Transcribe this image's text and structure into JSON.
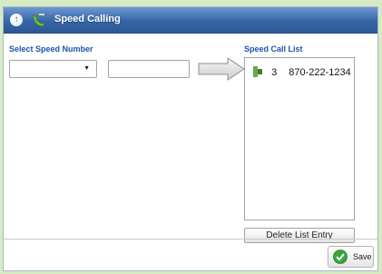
{
  "window": {
    "title": "Speed Calling"
  },
  "left_panel": {
    "label": "Select Speed Number",
    "select_value": "",
    "text_value": ""
  },
  "right_panel": {
    "label": "Speed Call List",
    "items": [
      {
        "number": "3",
        "phone": "870-222-1234"
      }
    ],
    "delete_label": "Delete List Entry"
  },
  "footer": {
    "save_label": "Save"
  },
  "icons": {
    "up": "up-arrow-icon",
    "title": "phone-icon",
    "transfer": "right-arrow-icon",
    "list_item": "phone-entry-icon",
    "save": "check-icon"
  },
  "colors": {
    "title_bar": "#3565a8",
    "label": "#1b54a6",
    "frame": "#d6ebc4",
    "save_check": "#3aa63a"
  }
}
